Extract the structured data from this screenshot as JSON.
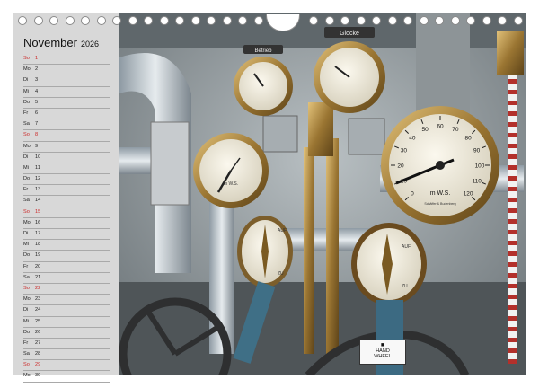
{
  "calendar": {
    "month": "November",
    "year": "2026",
    "days": [
      {
        "wd": "So",
        "d": "1",
        "red": true
      },
      {
        "wd": "Mo",
        "d": "2",
        "red": false
      },
      {
        "wd": "Di",
        "d": "3",
        "red": false
      },
      {
        "wd": "Mi",
        "d": "4",
        "red": false
      },
      {
        "wd": "Do",
        "d": "5",
        "red": false
      },
      {
        "wd": "Fr",
        "d": "6",
        "red": false
      },
      {
        "wd": "Sa",
        "d": "7",
        "red": false
      },
      {
        "wd": "So",
        "d": "8",
        "red": true
      },
      {
        "wd": "Mo",
        "d": "9",
        "red": false
      },
      {
        "wd": "Di",
        "d": "10",
        "red": false
      },
      {
        "wd": "Mi",
        "d": "11",
        "red": false
      },
      {
        "wd": "Do",
        "d": "12",
        "red": false
      },
      {
        "wd": "Fr",
        "d": "13",
        "red": false
      },
      {
        "wd": "Sa",
        "d": "14",
        "red": false
      },
      {
        "wd": "So",
        "d": "15",
        "red": true
      },
      {
        "wd": "Mo",
        "d": "16",
        "red": false
      },
      {
        "wd": "Di",
        "d": "17",
        "red": false
      },
      {
        "wd": "Mi",
        "d": "18",
        "red": false
      },
      {
        "wd": "Do",
        "d": "19",
        "red": false
      },
      {
        "wd": "Fr",
        "d": "20",
        "red": false
      },
      {
        "wd": "Sa",
        "d": "21",
        "red": false
      },
      {
        "wd": "So",
        "d": "22",
        "red": true
      },
      {
        "wd": "Mo",
        "d": "23",
        "red": false
      },
      {
        "wd": "Di",
        "d": "24",
        "red": false
      },
      {
        "wd": "Mi",
        "d": "25",
        "red": false
      },
      {
        "wd": "Do",
        "d": "26",
        "red": false
      },
      {
        "wd": "Fr",
        "d": "27",
        "red": false
      },
      {
        "wd": "Sa",
        "d": "28",
        "red": false
      },
      {
        "wd": "So",
        "d": "29",
        "red": true
      },
      {
        "wd": "Mo",
        "d": "30",
        "red": false
      }
    ]
  },
  "photo": {
    "gauge_large_labels": [
      "0",
      "10",
      "20",
      "30",
      "40",
      "50",
      "60",
      "70",
      "80",
      "90",
      "100",
      "110",
      "120"
    ],
    "gauge_large_unit": "m W.S.",
    "gauge_large_maker": "Schäffer & Budenberg",
    "gauge_top_left_label": "Betrieb",
    "gauge_top_right_label": "Glocke",
    "gauge_mid_left_unit": "m W.S.",
    "dial_left_labels": [
      "AUF",
      "ZU"
    ],
    "dial_right_labels": [
      "AUF",
      "ZU"
    ],
    "caption_line1": "HAND",
    "caption_line2": "WHEEL"
  }
}
